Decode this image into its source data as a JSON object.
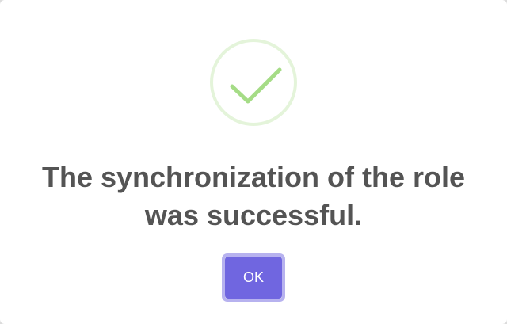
{
  "dialog": {
    "icon": "success-check-icon",
    "title": "The synchronization of the role was successful.",
    "confirm_label": "OK"
  },
  "colors": {
    "success": "#a5dc86",
    "confirm_button": "#7066e0",
    "title_text": "#545454"
  }
}
